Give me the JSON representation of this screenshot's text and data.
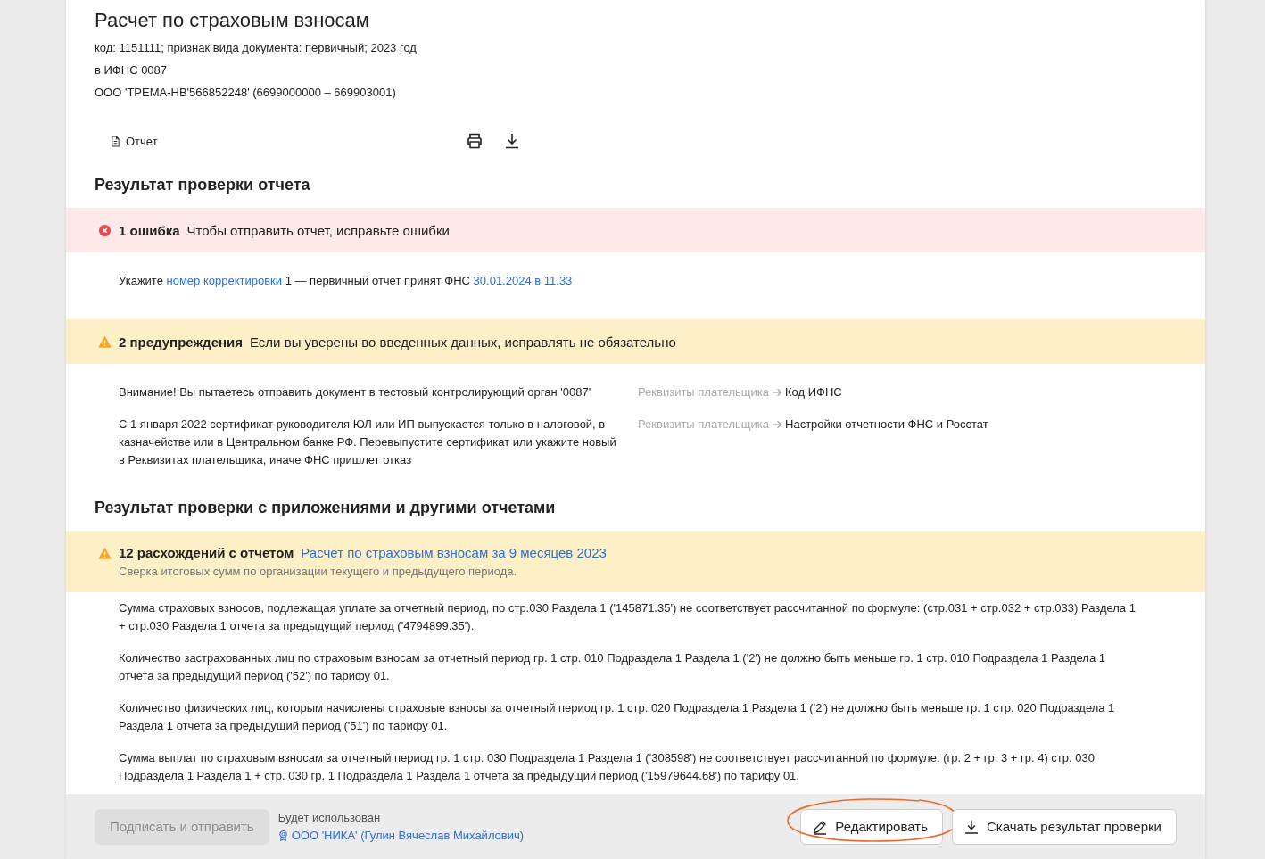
{
  "document": {
    "title": "Расчет по страховым взносам",
    "meta": [
      "код: 1151111; признак вида документа: первичный; 2023 год",
      "в ИФНС 0087",
      "ООО 'ТРЕМА-НВ'566852248' (6699000000 – 669903001)"
    ]
  },
  "toolbar": {
    "report_label": "Отчет"
  },
  "check": {
    "heading": "Результат проверки отчета",
    "groups": [
      {
        "kind": "error",
        "count_label": "1 ошибка",
        "message": "Чтобы отправить отчет, исправьте ошибки",
        "items": [
          {
            "segments": [
              {
                "text": "Укажите ",
                "link": false
              },
              {
                "text": "номер корректировки",
                "link": true
              },
              {
                "text": " 1 — первичный отчет принят ФНС ",
                "link": false
              },
              {
                "text": "30.01.2024 в 11.33",
                "link": true
              }
            ]
          }
        ]
      },
      {
        "kind": "warning",
        "count_label": "2 предупреждения",
        "message": "Если вы уверены во введенных данных, исправлять не обязательно",
        "items": [
          {
            "text": "Внимание! Вы пытаетесь отправить документ в тестовый контролирующий орган '0087'",
            "path_from": "Реквизиты плательщика",
            "path_to": "Код ИФНС"
          },
          {
            "text": "С 1 января 2022 сертификат руководителя ЮЛ или ИП выпускается только в налоговой, в казначействе или в Центральном банке РФ. Перевыпустите сертификат или укажите новый в Реквизитах плательщика, иначе ФНС пришлет отказ",
            "path_from": "Реквизиты плательщика",
            "path_to": "Настройки отчетности ФНС и Росстат"
          }
        ]
      }
    ]
  },
  "cross_check": {
    "heading": "Результат проверки с приложениями и другими отчетами",
    "kind": "warning",
    "title": "12 расхождений с отчетом",
    "link": "Расчет по страховым взносам за 9 месяцев 2023",
    "subtitle": "Сверка итоговых сумм по организации текущего и предыдущего периода.",
    "items": [
      "Сумма страховых взносов, подлежащая уплате за отчетный период, по стр.030 Раздела 1 ('145871.35') не соответствует рассчитанной по формуле: (стр.031 + стр.032 + стр.033) Раздела 1 + стр.030 Раздела 1 отчета за предыдущий период ('4794899.35').",
      "Количество застрахованных лиц по страховым взносам за отчетный период гр. 1 стр. 010 Подраздела 1 Раздела 1 ('2') не должно быть меньше гр. 1 стр. 010 Подраздела 1 Раздела 1 отчета за предыдущий период ('52') по тарифу 01.",
      "Количество физических лиц, которым начислены страховые взносы за отчетный период гр. 1 стр. 020 Подраздела 1 Раздела 1 ('2') не должно быть меньше гр. 1 стр. 020 Подраздела 1 Раздела 1 отчета за предыдущий период ('51') по тарифу 01.",
      "Сумма выплат по страховым взносам за отчетный период гр. 1 стр. 030 Подраздела 1 Раздела 1 ('308598') не соответствует рассчитанной по формуле: (гр. 2 + гр. 3 + гр. 4) стр. 030 Подраздела 1 Раздела 1 + стр. 030 гр. 1 Подраздела 1 Раздела 1 отчета за предыдущий период ('15979644.68') по тарифу 01."
    ]
  },
  "footer": {
    "sign_button": {
      "label": "Подписать и отправить",
      "disabled": true
    },
    "signer": {
      "caption": "Будет использован",
      "name": "ООО 'НИКА' (Гулин Вячеслав Михайлович)"
    },
    "buttons": [
      {
        "kind": "edit",
        "label": "Редактировать",
        "highlighted": true
      },
      {
        "kind": "download",
        "label": "Скачать результат проверки",
        "highlighted": false
      }
    ]
  }
}
